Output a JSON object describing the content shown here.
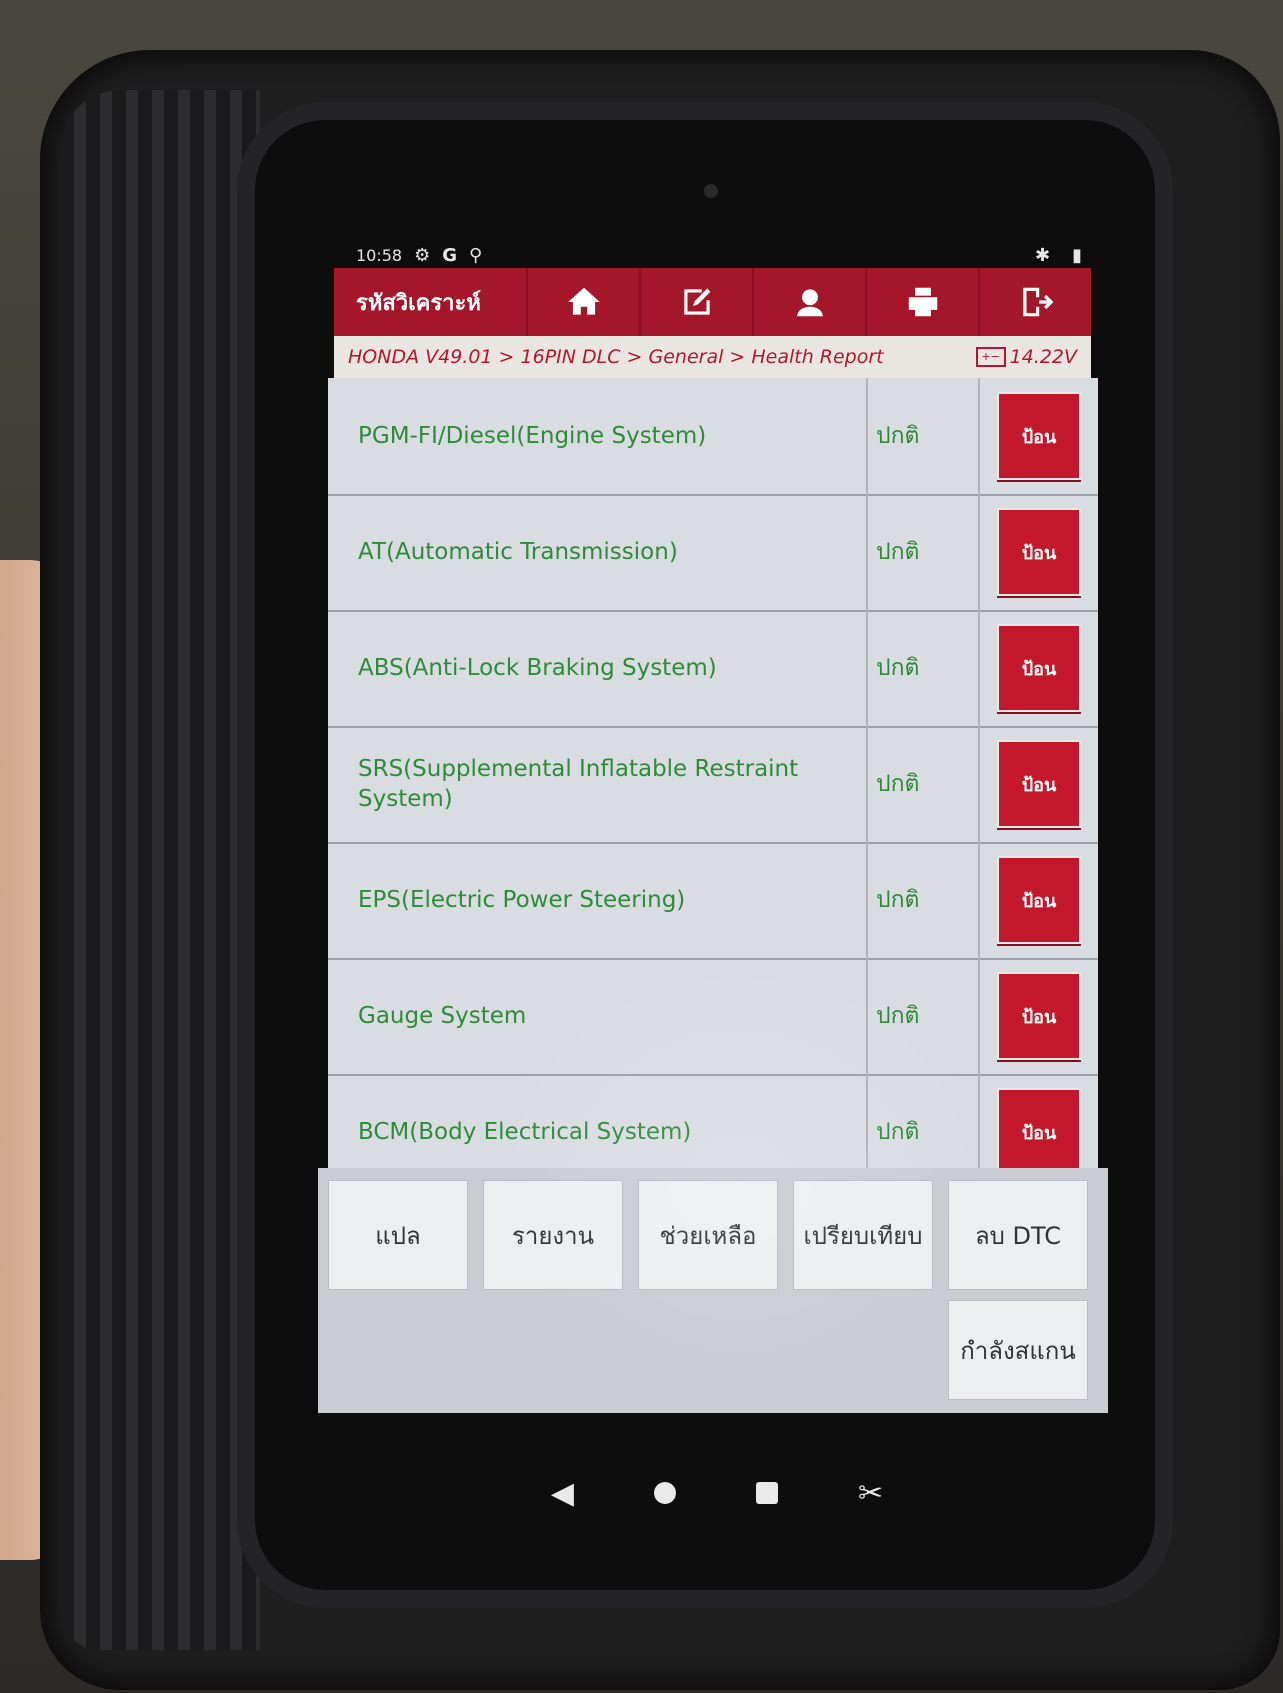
{
  "status_bar": {
    "time": "10:58",
    "icons": [
      "settings-cog-icon",
      "google-g-icon",
      "usb-icon"
    ],
    "right_icons": [
      "bluetooth-icon",
      "battery-icon"
    ]
  },
  "toolbar": {
    "title": "รหัสวิเคราะห์",
    "buttons": [
      {
        "name": "home-icon"
      },
      {
        "name": "edit-icon"
      },
      {
        "name": "support-agent-icon"
      },
      {
        "name": "printer-icon"
      },
      {
        "name": "exit-icon"
      }
    ],
    "accent": "#a4162a"
  },
  "breadcrumb": {
    "path": "HONDA V49.01 > 16PIN DLC > General > Health Report",
    "voltage": "14.22V"
  },
  "systems": [
    {
      "name": "PGM-FI/Diesel(Engine System)",
      "status": "ปกติ",
      "action": "ป้อน"
    },
    {
      "name": "AT(Automatic Transmission)",
      "status": "ปกติ",
      "action": "ป้อน"
    },
    {
      "name": "ABS(Anti-Lock Braking System)",
      "status": "ปกติ",
      "action": "ป้อน"
    },
    {
      "name": "SRS(Supplemental Inflatable Restraint System)",
      "status": "ปกติ",
      "action": "ป้อน"
    },
    {
      "name": "EPS(Electric Power Steering)",
      "status": "ปกติ",
      "action": "ป้อน"
    },
    {
      "name": "Gauge System",
      "status": "ปกติ",
      "action": "ป้อน"
    },
    {
      "name": "BCM(Body Electrical System)",
      "status": "ปกติ",
      "action": "ป้อน"
    }
  ],
  "bottom_buttons": {
    "translate": "แปล",
    "report": "รายงาน",
    "help": "ช่วยเหลือ",
    "compare": "เปรียบเทียบ",
    "clear_dtc": "ลบ DTC",
    "scanning": "กำลังสแกน"
  },
  "nav": {
    "icons": [
      "back-icon",
      "home-circle-icon",
      "recents-icon",
      "screenshot-icon"
    ]
  },
  "colors": {
    "status_text": "#2f8a3a",
    "action_button": "#c3182c",
    "breadcrumb_text": "#b5162d"
  }
}
